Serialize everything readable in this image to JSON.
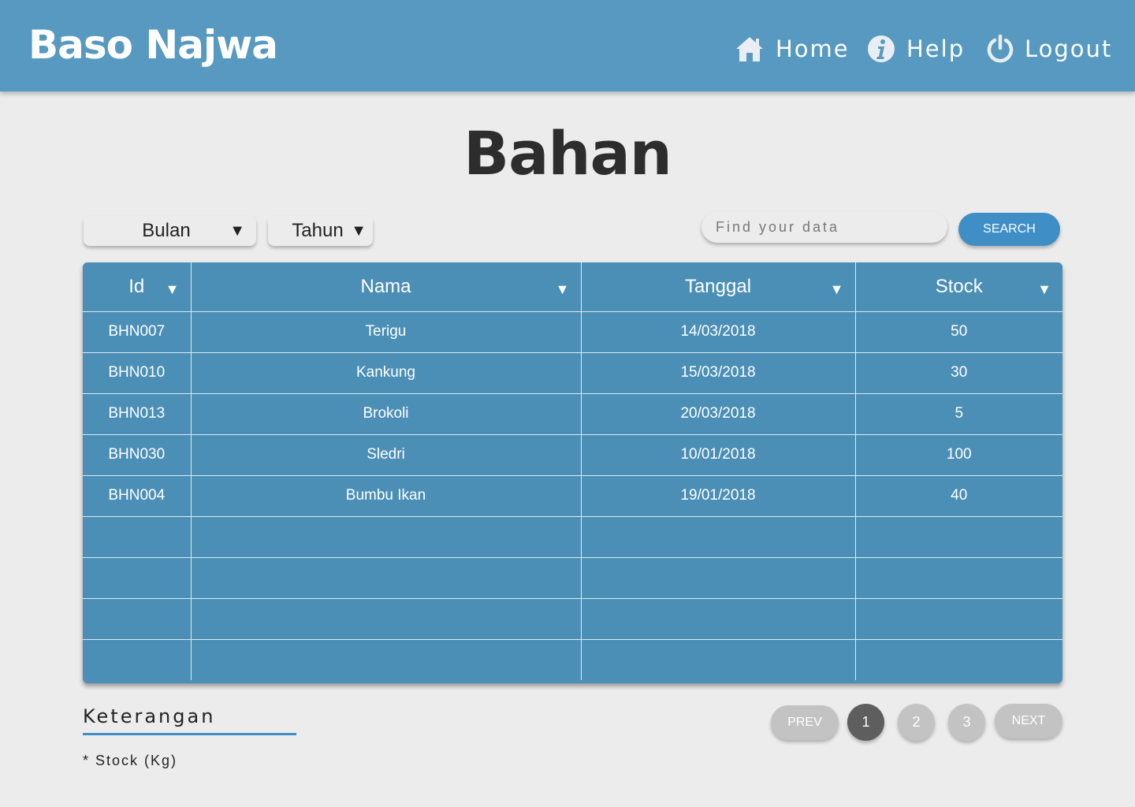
{
  "header": {
    "brand": "Baso Najwa",
    "nav": {
      "home": "Home",
      "help": "Help",
      "logout": "Logout"
    }
  },
  "page": {
    "title": "Bahan"
  },
  "filters": {
    "month_label": "Bulan",
    "year_label": "Tahun",
    "search_placeholder": "Find your data",
    "search_button": "SEARCH"
  },
  "table": {
    "columns": [
      "Id",
      "Nama",
      "Tanggal",
      "Stock"
    ],
    "rows": [
      [
        "BHN007",
        "Terigu",
        "14/03/2018",
        "50"
      ],
      [
        "BHN010",
        "Kankung",
        "15/03/2018",
        "30"
      ],
      [
        "BHN013",
        "Brokoli",
        "20/03/2018",
        "5"
      ],
      [
        "BHN030",
        "Sledri",
        "10/01/2018",
        "100"
      ],
      [
        "BHN004",
        "Bumbu Ikan",
        "19/01/2018",
        "40"
      ],
      [
        "",
        "",
        "",
        ""
      ],
      [
        "",
        "",
        "",
        ""
      ],
      [
        "",
        "",
        "",
        ""
      ],
      [
        "",
        "",
        "",
        ""
      ]
    ]
  },
  "notes": {
    "title": "Keterangan",
    "items": [
      "* Stock (Kg)"
    ]
  },
  "pagination": {
    "prev": "PREV",
    "next": "NEXT",
    "pages": [
      "1",
      "2",
      "3"
    ],
    "current": "1"
  },
  "colors": {
    "header": "#5799c0",
    "table": "#4b8fb6",
    "accent": "#3f8fc6",
    "active_page": "#5e5e5e",
    "inactive_page": "#c3c3c3"
  }
}
